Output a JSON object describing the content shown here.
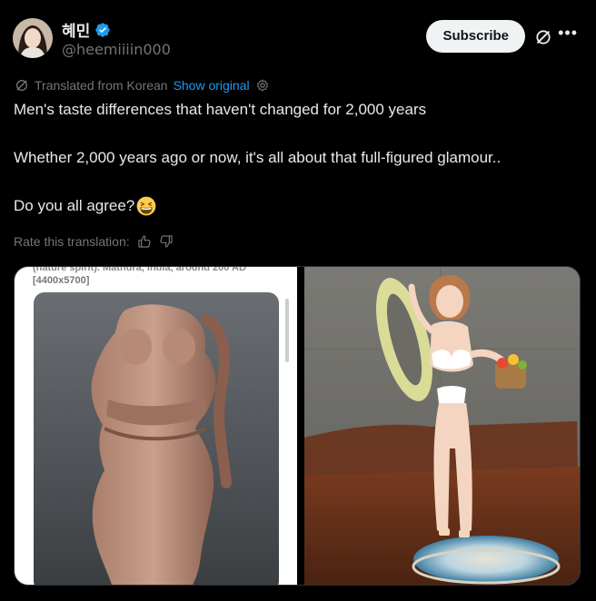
{
  "author": {
    "display_name": "혜민",
    "handle": "@heemiiiin000",
    "verified": true
  },
  "actions": {
    "subscribe_label": "Subscribe",
    "grok_icon": "grok-icon",
    "more_icon": "more-icon"
  },
  "translation": {
    "translated_from": "Translated from Korean",
    "show_original": "Show original",
    "rate_label": "Rate this translation:"
  },
  "tweet": {
    "line1": "Men's taste differences that haven't changed for 2,000 years",
    "line2": "Whether 2,000 years ago or now, it's all about that full-figured glamour..",
    "line3": "Do you all agree?",
    "emoji": "grinning-squinting-face"
  },
  "media": {
    "left_caption_cut": "(nature spirit). Mathura, India, around 200 AD",
    "left_caption_size": "[4400x5700]"
  },
  "colors": {
    "background": "#000000",
    "text": "#e7e9ea",
    "muted": "#71767b",
    "link": "#1d9bf0",
    "verified": "#1d9bf0"
  }
}
